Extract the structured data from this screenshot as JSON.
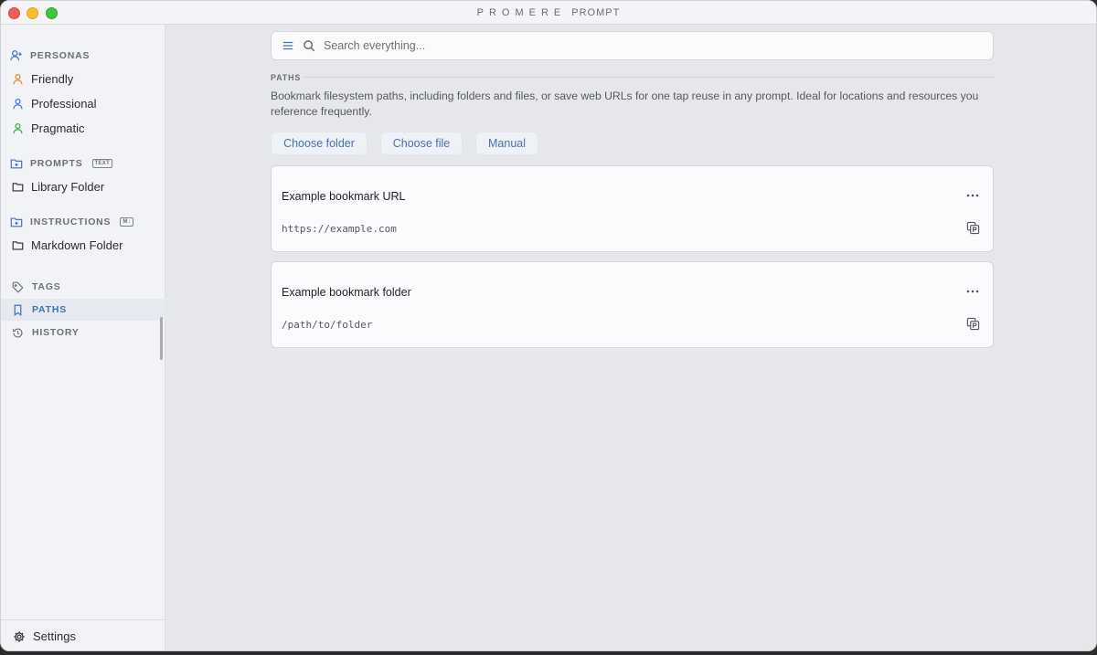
{
  "window": {
    "brand": "PROMERE",
    "product": "PROMPT"
  },
  "sidebar": {
    "personas": {
      "label": "PERSONAS",
      "items": [
        {
          "label": "Friendly",
          "color": "#e58a2b"
        },
        {
          "label": "Professional",
          "color": "#3a7bd5"
        },
        {
          "label": "Pragmatic",
          "color": "#3aaa4a"
        }
      ]
    },
    "prompts": {
      "label": "PROMPTS",
      "badge": "TEXT",
      "items": [
        {
          "label": "Library Folder"
        }
      ]
    },
    "instructions": {
      "label": "INSTRUCTIONS",
      "badge": "M↓",
      "items": [
        {
          "label": "Markdown Folder"
        }
      ]
    },
    "nav": [
      {
        "label": "TAGS",
        "icon": "tag-icon",
        "active": false
      },
      {
        "label": "PATHS",
        "icon": "bookmark-icon",
        "active": true
      },
      {
        "label": "HISTORY",
        "icon": "history-icon",
        "active": false
      }
    ],
    "footer": {
      "label": "Settings",
      "icon": "gear-icon"
    }
  },
  "search": {
    "placeholder": "Search everything..."
  },
  "paths": {
    "label": "PATHS",
    "description": "Bookmark filesystem paths, including folders and files, or save web URLs for one tap reuse in any prompt. Ideal for locations and resources you reference frequently.",
    "buttons": {
      "choose_folder": "Choose folder",
      "choose_file": "Choose file",
      "manual": "Manual"
    },
    "bookmarks": [
      {
        "title": "Example bookmark URL",
        "path": "https://example.com"
      },
      {
        "title": "Example bookmark folder",
        "path": "/path/to/folder"
      }
    ]
  },
  "colors": {
    "accent": "#3f73b5",
    "sidebar_bg": "#f2f3f6",
    "main_bg": "#e6e7eb"
  }
}
